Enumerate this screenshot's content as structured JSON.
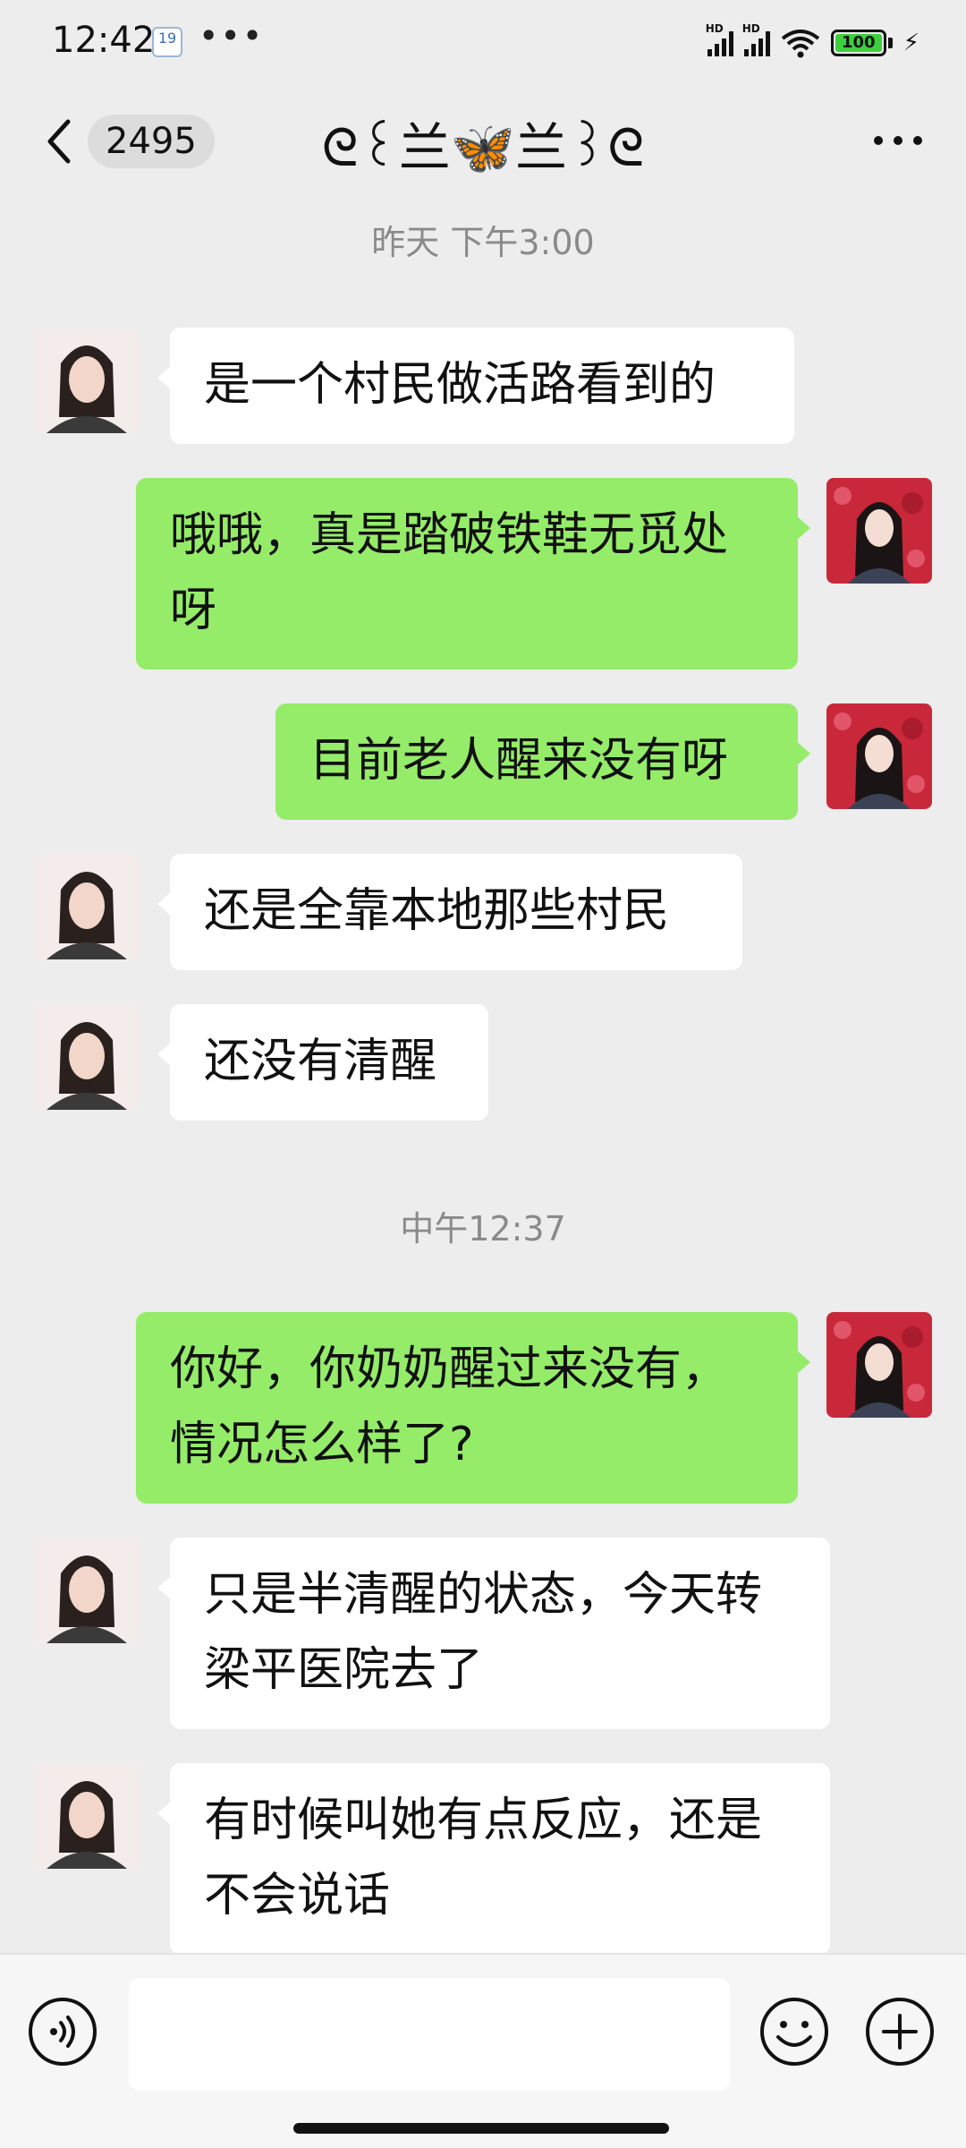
{
  "status_bar": {
    "time": "12:42",
    "notification_badge": "19",
    "more_dots": "•••",
    "battery": "100",
    "network_labels": [
      "HD",
      "HD"
    ]
  },
  "header": {
    "unread_count": "2495",
    "title": "ᘓ꒰兰🦋兰꒱ᘓ"
  },
  "messages": [
    {
      "type": "timestamp",
      "text": "昨天 下午3:00"
    },
    {
      "type": "message",
      "side": "in",
      "lines": [
        "是一个村民做活路看到的"
      ]
    },
    {
      "type": "message",
      "side": "out",
      "lines": [
        "哦哦，真是踏破铁鞋无觅处",
        "呀"
      ]
    },
    {
      "type": "message",
      "side": "out",
      "lines": [
        "目前老人醒来没有呀"
      ]
    },
    {
      "type": "message",
      "side": "in",
      "lines": [
        "还是全靠本地那些村民"
      ]
    },
    {
      "type": "message",
      "side": "in",
      "lines": [
        "还没有清醒"
      ]
    },
    {
      "type": "timestamp",
      "text": "中午12:37"
    },
    {
      "type": "message",
      "side": "out",
      "lines": [
        "你好，你奶奶醒过来没有，",
        "情况怎么样了?"
      ]
    },
    {
      "type": "message",
      "side": "in",
      "lines": [
        "只是半清醒的状态，今天转",
        "梁平医院去了"
      ]
    },
    {
      "type": "message",
      "side": "in",
      "lines": [
        "有时候叫她有点反应，还是",
        "不会说话"
      ]
    }
  ],
  "input": {
    "value": "",
    "placeholder": ""
  },
  "icons": {
    "back": "back-chevron-icon",
    "more": "more-horizontal-icon",
    "voice": "voice-icon",
    "emoji": "emoji-icon",
    "plus": "plus-icon"
  },
  "colors": {
    "background": "#ededed",
    "outgoing_bubble": "#95ec69",
    "incoming_bubble": "#ffffff",
    "timestamp_text": "#8a8a8a",
    "battery_fill": "#3ecf3e"
  }
}
